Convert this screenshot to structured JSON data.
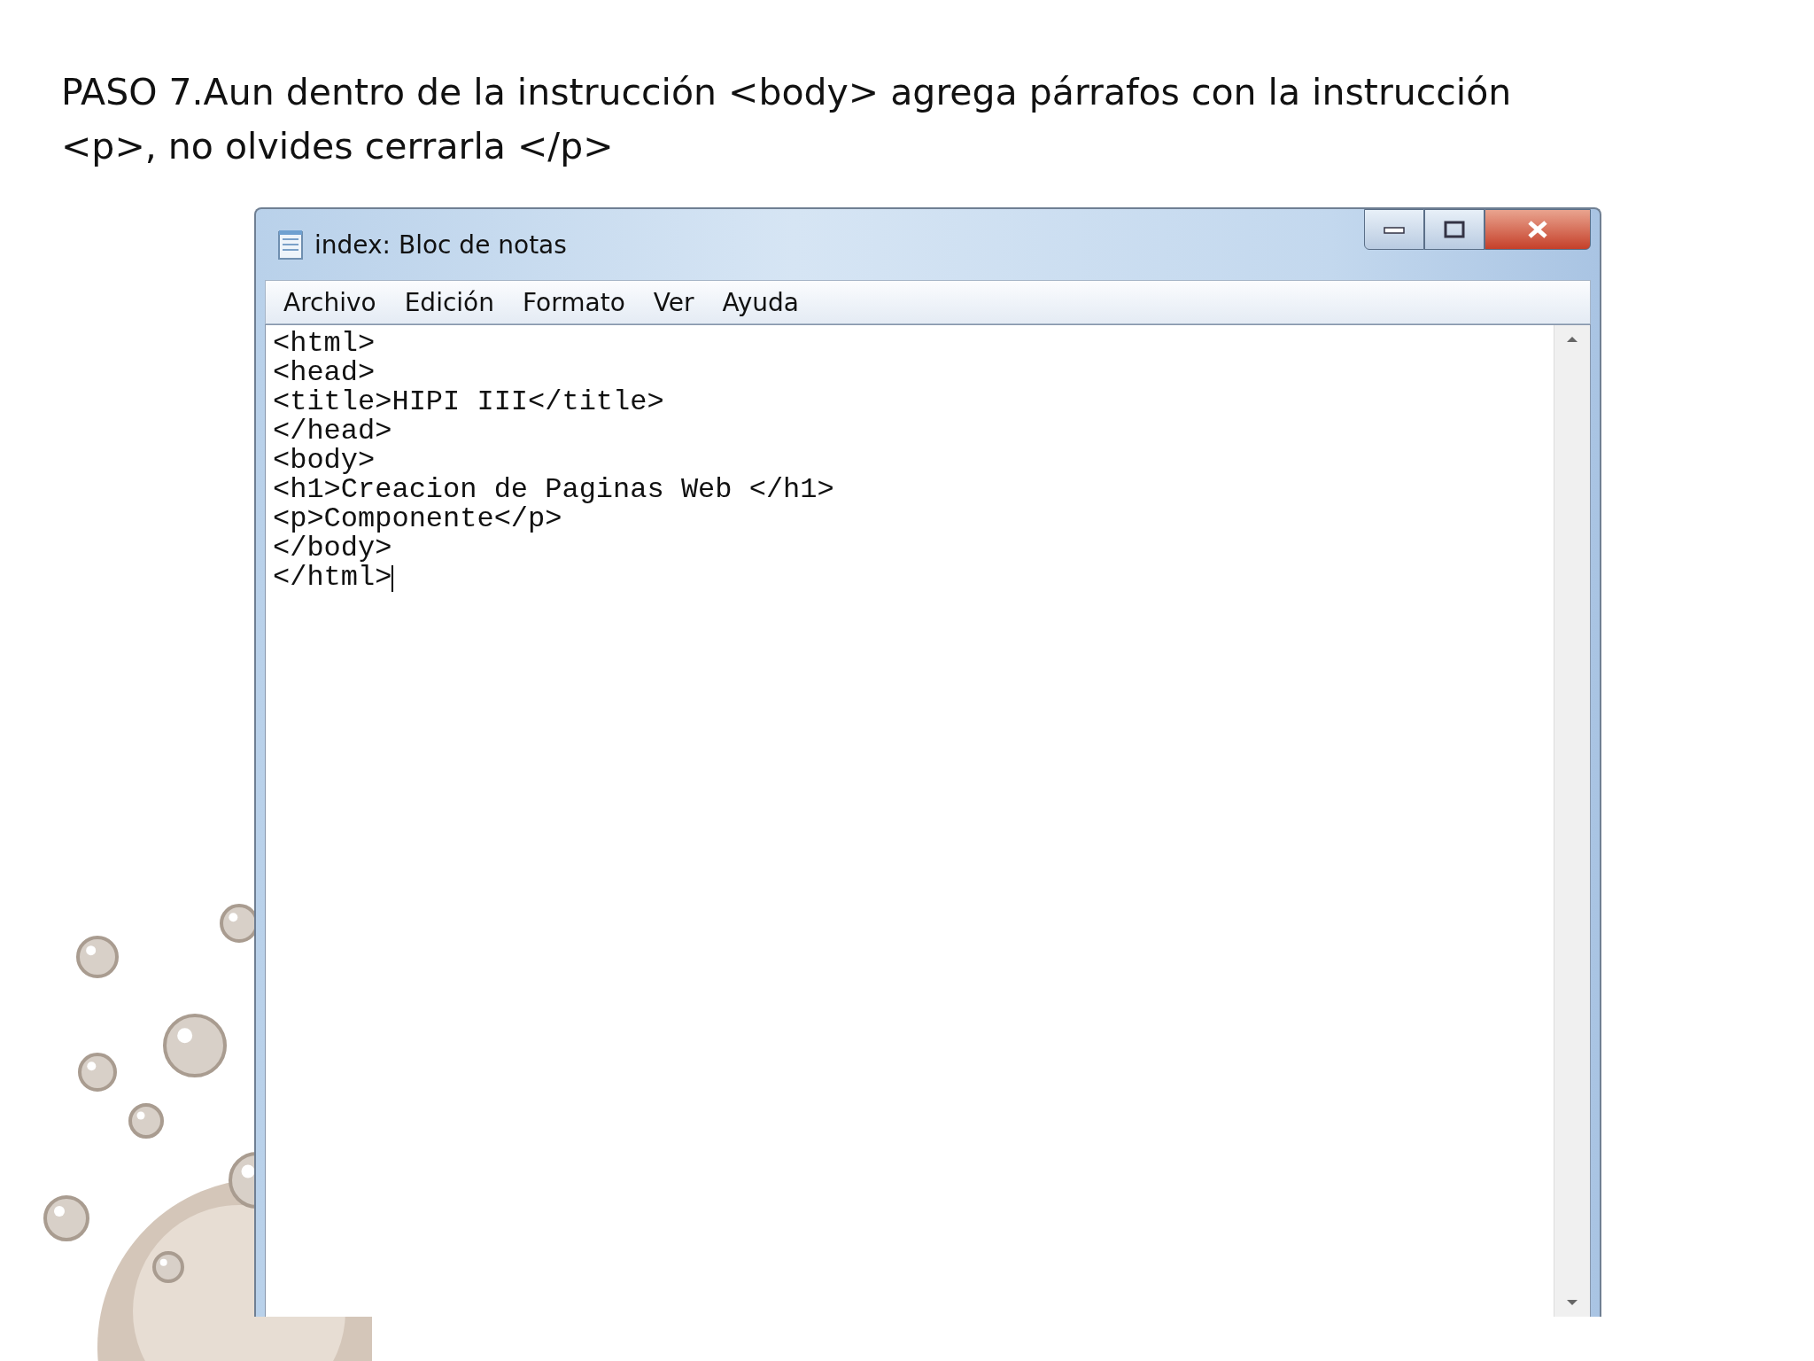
{
  "instruction": "PASO 7.Aun dentro de la instrucción <body> agrega párrafos con la instrucción <p>, no olvides cerrarla </p>",
  "window": {
    "title": "index: Bloc de notas"
  },
  "menu": [
    "Archivo",
    "Edición",
    "Formato",
    "Ver",
    "Ayuda"
  ],
  "editor": {
    "lines": [
      "<html>",
      "<head>",
      "<title>HIPI III</title>",
      "</head>",
      "<body>",
      "<h1>Creacion de Paginas Web </h1>",
      "<p>Componente</p>",
      "</body>",
      "</html>"
    ]
  }
}
